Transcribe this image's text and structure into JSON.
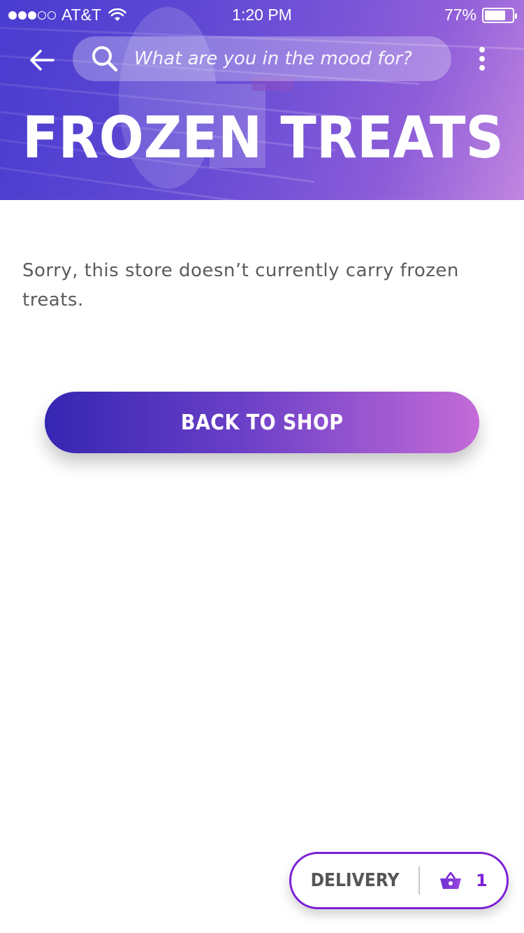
{
  "status_bar": {
    "carrier": "AT&T",
    "time": "1:20 PM",
    "battery_percent_label": "77%",
    "battery_level": 0.77,
    "signal_bars_filled": 3,
    "signal_bars_total": 5
  },
  "header": {
    "search_placeholder": "What are you in the mood for?",
    "title": "FROZEN TREATS",
    "icons": [
      "back-arrow-icon",
      "search-icon",
      "more-vertical-icon"
    ]
  },
  "main": {
    "message": "Sorry, this store doesn’t currently carry frozen treats.",
    "cta_label": "BACK TO SHOP"
  },
  "footer_pill": {
    "delivery_label": "DELIVERY",
    "cart_count": "1",
    "icons": [
      "basket-icon"
    ]
  },
  "colors": {
    "accent_purple": "#7d1fd6",
    "gradient_start": "#3526b2",
    "gradient_end": "#c46bd8",
    "hero_purple": "#6a4ed6"
  }
}
